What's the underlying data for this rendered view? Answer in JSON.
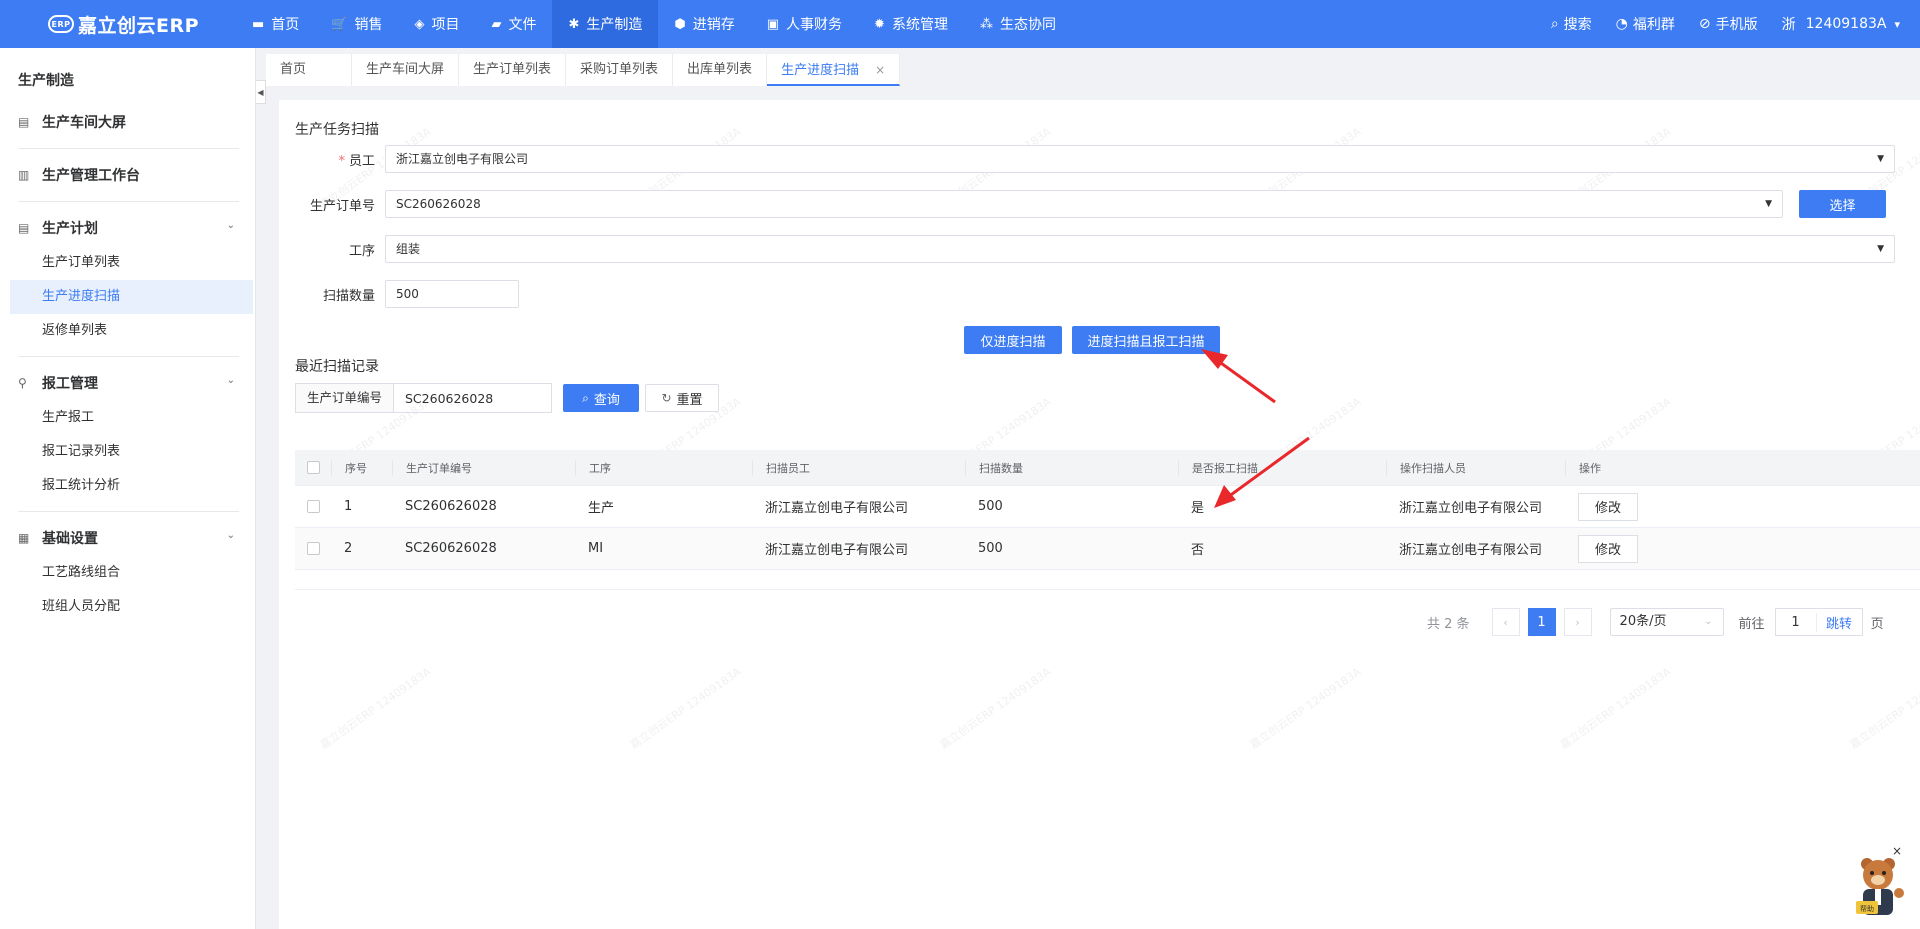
{
  "header": {
    "logo_badge": "ERP",
    "logo_text": "嘉立创云ERP",
    "nav": [
      {
        "label": "首页",
        "icon": "monitor-icon",
        "glyph": "▬"
      },
      {
        "label": "销售",
        "icon": "cart-icon",
        "glyph": "🛒"
      },
      {
        "label": "项目",
        "icon": "layers-icon",
        "glyph": "◈"
      },
      {
        "label": "文件",
        "icon": "folder-icon",
        "glyph": "▰"
      },
      {
        "label": "生产制造",
        "icon": "gear-icon",
        "glyph": "✱"
      },
      {
        "label": "进销存",
        "icon": "box-icon",
        "glyph": "⬢"
      },
      {
        "label": "人事财务",
        "icon": "id-card-icon",
        "glyph": "▣"
      },
      {
        "label": "系统管理",
        "icon": "cog-icon",
        "glyph": "✹"
      },
      {
        "label": "生态协同",
        "icon": "cluster-icon",
        "glyph": "⁂"
      }
    ],
    "active_index": 4,
    "right": {
      "search": "搜索",
      "welfare": "福利群",
      "mobile": "手机版",
      "region": "浙",
      "user": "12409183A",
      "user_caret": "▾"
    }
  },
  "sidebar": {
    "title": "生产制造",
    "groups": [
      {
        "label": "生产车间大屏",
        "icon": "dashboard-icon",
        "glyph": "▤"
      },
      {
        "label": "生产管理工作台",
        "icon": "chart-icon",
        "glyph": "▥"
      },
      {
        "label": "生产计划",
        "icon": "plan-icon",
        "glyph": "▤",
        "items": [
          "生产订单列表",
          "生产进度扫描",
          "返修单列表"
        ]
      },
      {
        "label": "报工管理",
        "icon": "org-icon",
        "glyph": "⚲",
        "items": [
          "生产报工",
          "报工记录列表",
          "报工统计分析"
        ]
      },
      {
        "label": "基础设置",
        "icon": "settings-icon",
        "glyph": "▦",
        "items": [
          "工艺路线组合",
          "班组人员分配"
        ]
      }
    ],
    "active_item": "生产进度扫描",
    "collapse_glyph": "◀"
  },
  "tabs": [
    {
      "label": "首页"
    },
    {
      "label": "生产车间大屏"
    },
    {
      "label": "生产订单列表"
    },
    {
      "label": "采购订单列表"
    },
    {
      "label": "出库单列表"
    },
    {
      "label": "生产进度扫描",
      "closable": true
    }
  ],
  "tab_close": "×",
  "scan_form": {
    "title": "生产任务扫描",
    "employee_label": "员工",
    "employee_required": "*",
    "employee_value": "浙江嘉立创电子有限公司",
    "order_label": "生产订单号",
    "order_value": "SC260626028",
    "select_button": "选择",
    "process_label": "工序",
    "process_value": "组装",
    "qty_label": "扫描数量",
    "qty_value": "500",
    "btn_progress_only": "仅进度扫描",
    "btn_progress_and_report": "进度扫描且报工扫描",
    "arrow_glyph": "▼"
  },
  "records": {
    "title": "最近扫描记录",
    "search_label": "生产订单编号",
    "search_value": "SC260626028",
    "query_button": "查询",
    "reset_button": "重置",
    "columns": [
      "序号",
      "生产订单编号",
      "工序",
      "扫描员工",
      "扫描数量",
      "是否报工扫描",
      "操作扫描人员",
      "操作"
    ],
    "rows": [
      {
        "no": "1",
        "order": "SC260626028",
        "process": "生产",
        "employee": "浙江嘉立创电子有限公司",
        "qty": "500",
        "reported": "是",
        "operator": "浙江嘉立创电子有限公司",
        "action": "修改"
      },
      {
        "no": "2",
        "order": "SC260626028",
        "process": "MI",
        "employee": "浙江嘉立创电子有限公司",
        "qty": "500",
        "reported": "否",
        "operator": "浙江嘉立创电子有限公司",
        "action": "修改"
      }
    ]
  },
  "pagination": {
    "total": "共 2 条",
    "current": "1",
    "prev": "‹",
    "next": "›",
    "page_size": "20条/页",
    "goto_label": "前往",
    "goto_value": "1",
    "jump": "跳转",
    "page_unit": "页"
  },
  "watermark_text": "嘉立创云ERP 12409183A",
  "mascot_label": "帮助",
  "mascot_close": "×",
  "colors": {
    "primary": "#3d7cf2",
    "annotation_arrow": "#e8282b"
  }
}
